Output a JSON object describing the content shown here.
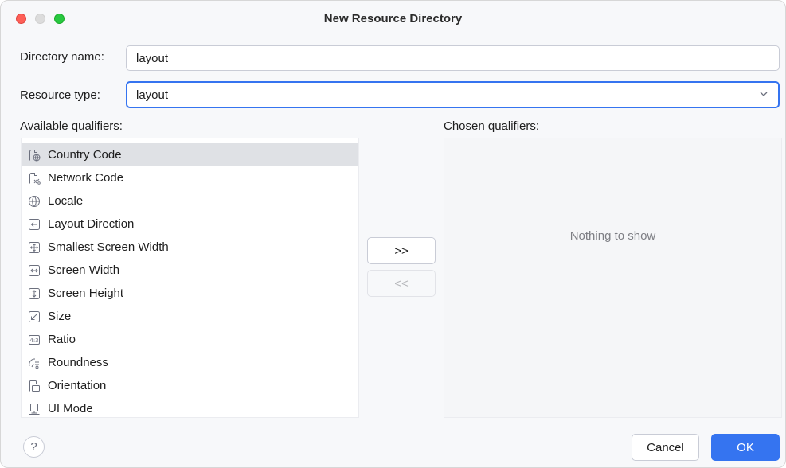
{
  "window": {
    "title": "New Resource Directory"
  },
  "form": {
    "directory_label": "Directory name:",
    "directory_value": "layout",
    "resource_type_label": "Resource type:",
    "resource_type_value": "layout"
  },
  "available": {
    "label": "Available qualifiers:",
    "items": [
      {
        "label": "Country Code",
        "icon": "country-code-icon"
      },
      {
        "label": "Network Code",
        "icon": "network-code-icon"
      },
      {
        "label": "Locale",
        "icon": "globe-icon"
      },
      {
        "label": "Layout Direction",
        "icon": "layout-direction-icon"
      },
      {
        "label": "Smallest Screen Width",
        "icon": "smallest-screen-width-icon"
      },
      {
        "label": "Screen Width",
        "icon": "screen-width-icon"
      },
      {
        "label": "Screen Height",
        "icon": "screen-height-icon"
      },
      {
        "label": "Size",
        "icon": "size-icon"
      },
      {
        "label": "Ratio",
        "icon": "ratio-icon"
      },
      {
        "label": "Roundness",
        "icon": "roundness-icon"
      },
      {
        "label": "Orientation",
        "icon": "orientation-icon"
      },
      {
        "label": "UI Mode",
        "icon": "ui-mode-icon"
      }
    ]
  },
  "chosen": {
    "label": "Chosen qualifiers:",
    "empty_text": "Nothing to show"
  },
  "buttons": {
    "add": ">>",
    "remove": "<<",
    "cancel": "Cancel",
    "ok": "OK",
    "help": "?"
  },
  "colors": {
    "accent": "#3574f0",
    "selection": "#dfe1e5",
    "muted": "#7e7f85"
  }
}
